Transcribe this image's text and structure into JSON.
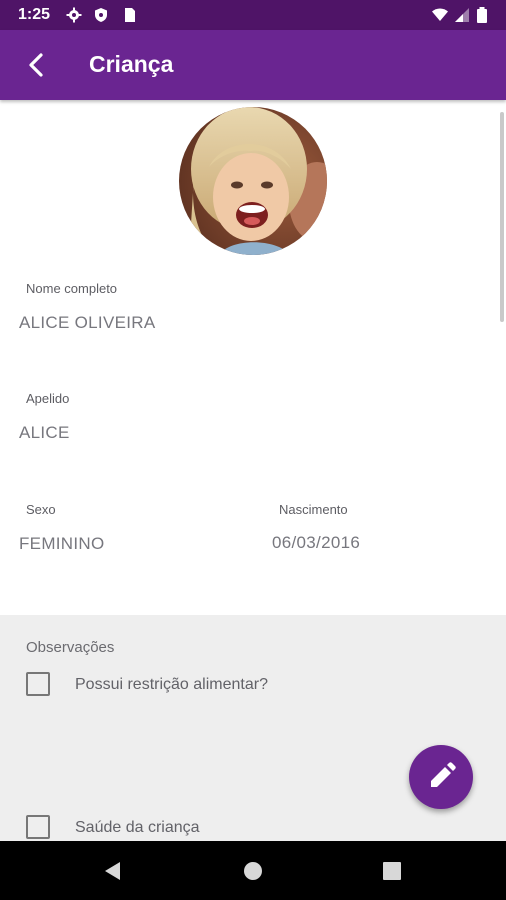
{
  "status_bar": {
    "time": "1:25"
  },
  "app_bar": {
    "title": "Criança"
  },
  "child": {
    "nome_label": "Nome completo",
    "nome_value": "ALICE OLIVEIRA",
    "apelido_label": "Apelido",
    "apelido_value": "ALICE",
    "sexo_label": "Sexo",
    "sexo_value": "FEMININO",
    "nascimento_label": "Nascimento",
    "nascimento_value": "06/03/2016"
  },
  "observacoes": {
    "title": "Observações",
    "items": [
      {
        "label": "Possui restrição alimentar?",
        "checked": false
      },
      {
        "label": "Saúde da criança",
        "checked": false
      }
    ]
  },
  "colors": {
    "primary": "#6a2591",
    "status_bar": "#4f1467"
  }
}
